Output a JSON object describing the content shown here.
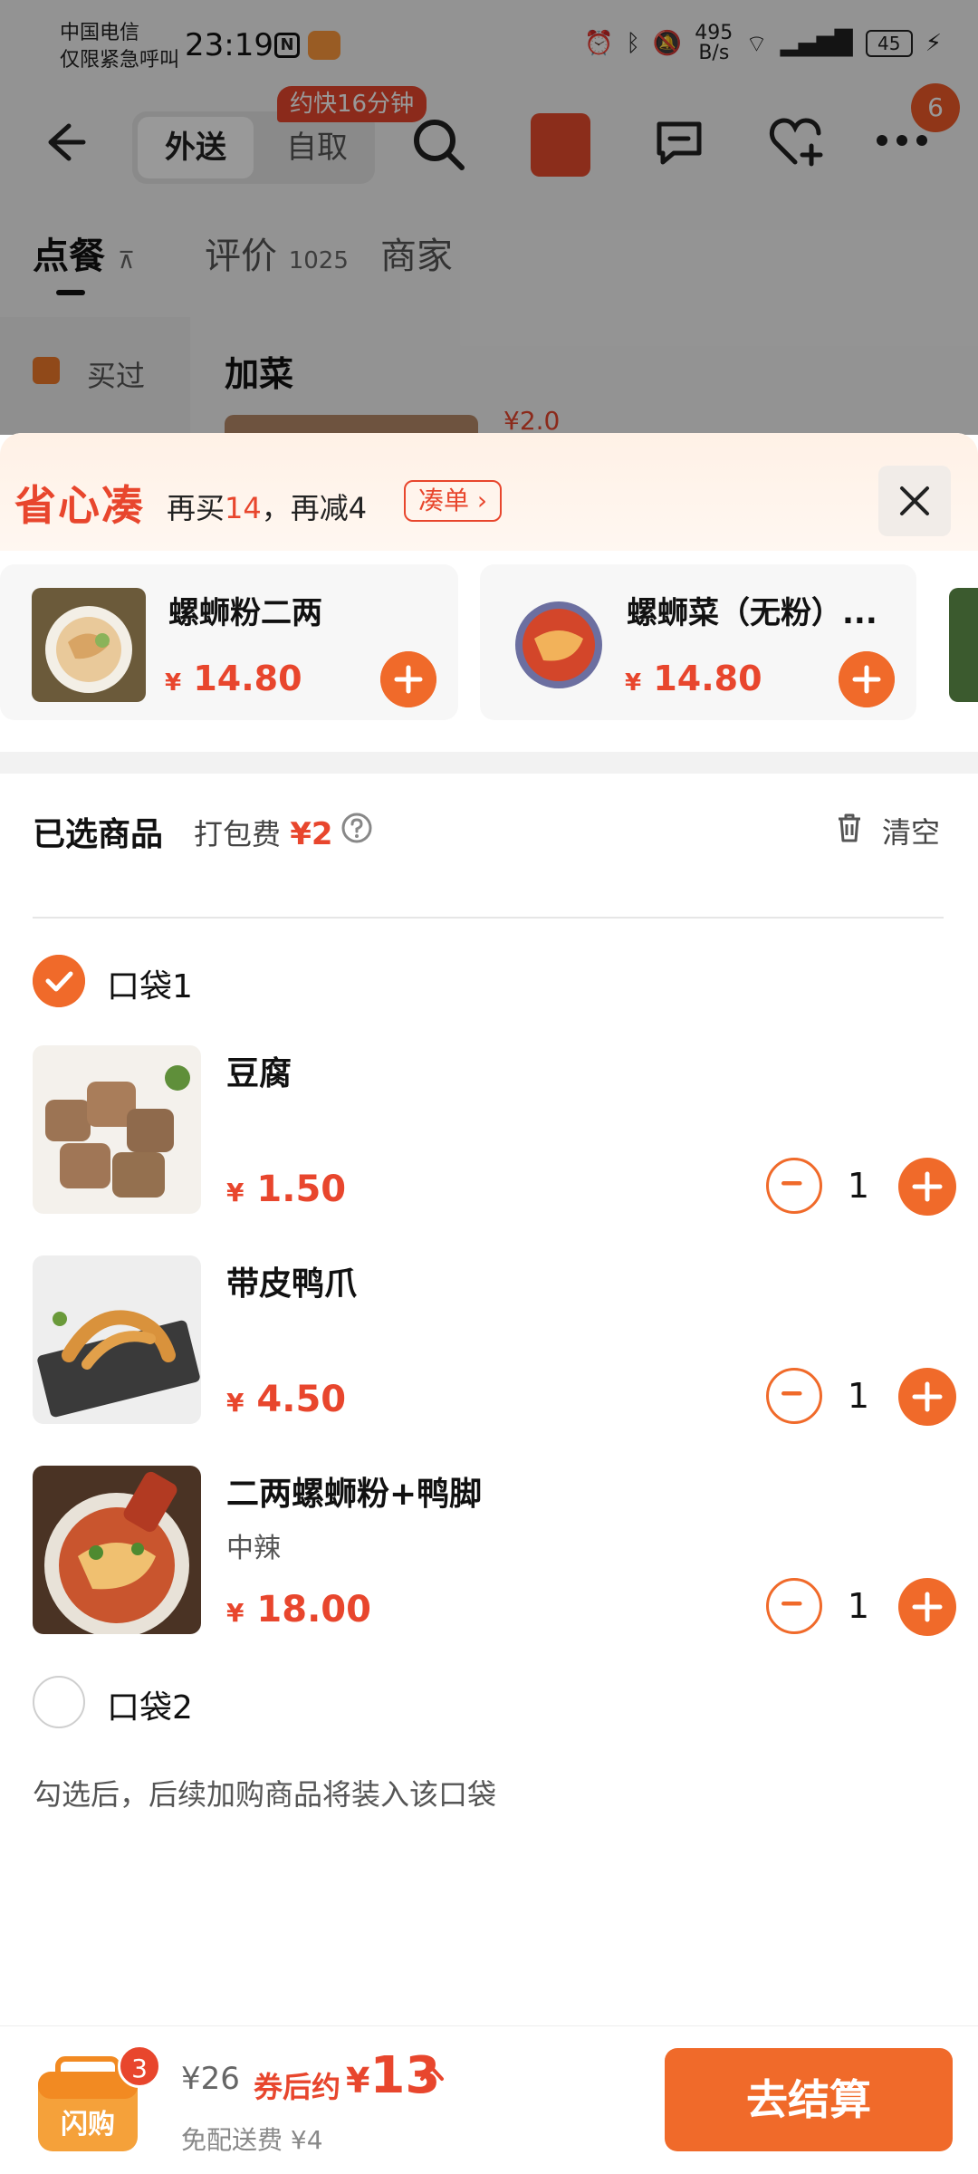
{
  "status_bar": {
    "carrier_line1": "中国电信",
    "carrier_line2": "仅限紧急呼叫",
    "time": "23:19",
    "n_icon": "N",
    "net_speed_value": "495",
    "net_speed_unit": "B/s",
    "battery": "45",
    "icons": [
      "alarm-icon",
      "bluetooth-icon",
      "mute-icon",
      "wifi-icon",
      "signal-5g-icon",
      "signal-icon",
      "charging-icon"
    ]
  },
  "topbar": {
    "mode_active": "外送",
    "mode_inactive": "自取",
    "speed_tag": "约快16分钟",
    "more_badge": "6",
    "icons": [
      "back-icon",
      "search-icon",
      "red-packet-icon",
      "chat-icon",
      "favorite-add-icon",
      "more-icon"
    ]
  },
  "tabs": {
    "order": "点餐",
    "reviews": "评价",
    "reviews_count": "1025",
    "merchant": "商家"
  },
  "sidebar": {
    "bought": "买过"
  },
  "section": {
    "title": "加菜",
    "peek_price": "¥2.0"
  },
  "promo": {
    "logo": "省心凑",
    "text_prefix": "再买",
    "buy_more": "14",
    "text_middle": "，再减",
    "discount": "4",
    "cta": "凑单 ›"
  },
  "recommendations": [
    {
      "name": "螺蛳粉二两",
      "yen": "¥",
      "price": "14.80"
    },
    {
      "name": "螺蛳菜（无粉）...",
      "yen": "¥",
      "price": "14.80"
    }
  ],
  "selected": {
    "title": "已选商品",
    "packing_fee_label": "打包费",
    "packing_fee": "¥2",
    "clear": "清空"
  },
  "bags": [
    {
      "label": "口袋1",
      "checked": true
    },
    {
      "label": "口袋2",
      "checked": false
    }
  ],
  "items": [
    {
      "name": "豆腐",
      "spec": "",
      "yen": "¥",
      "price": "1.50",
      "qty": "1"
    },
    {
      "name": "带皮鸭爪",
      "spec": "",
      "yen": "¥",
      "price": "4.50",
      "qty": "1"
    },
    {
      "name": "二两螺蛳粉+鸭脚",
      "spec": "中辣",
      "yen": "¥",
      "price": "18.00",
      "qty": "1"
    }
  ],
  "bag_hint": "勾选后，后续加购商品将装入该口袋",
  "bottom": {
    "cart_count": "3",
    "cart_logo_text": "闪购",
    "original_price": "¥26",
    "coupon_label": "券后约",
    "final_yen": "¥",
    "final_price": "13",
    "delivery_fee": "免配送费 ¥4",
    "checkout": "去结算"
  },
  "colors": {
    "accent": "#f06a2a",
    "price_red": "#e8462d"
  }
}
